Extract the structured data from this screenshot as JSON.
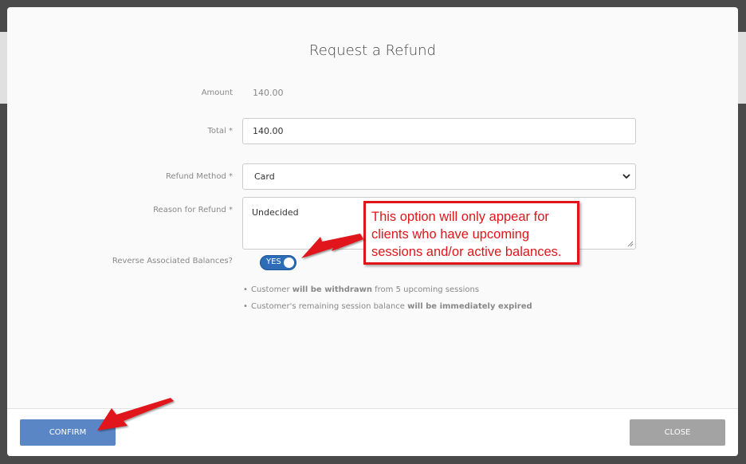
{
  "modal": {
    "title": "Request a Refund",
    "amount": {
      "label": "Amount",
      "value": "140.00"
    },
    "total": {
      "label": "Total *",
      "value": "140.00"
    },
    "refund_method": {
      "label": "Refund Method *",
      "value": "Card"
    },
    "reason": {
      "label": "Reason for Refund *",
      "value": "Undecided"
    },
    "reverse_balances": {
      "label": "Reverse Associated Balances?",
      "toggle_label": "YES",
      "on": true
    },
    "notes": [
      {
        "pre": "Customer ",
        "bold": "will be withdrawn",
        "post": " from 5 upcoming sessions"
      },
      {
        "pre": "Customer's remaining session balance ",
        "bold": "will be immediately expired",
        "post": ""
      }
    ]
  },
  "footer": {
    "confirm_label": "CONFIRM",
    "close_label": "CLOSE"
  },
  "annotation": {
    "text": "This option will only appear for clients who have upcoming sessions and/or active balances."
  },
  "colors": {
    "annotation_red": "#e0151a",
    "confirm_blue": "#5b86c6",
    "toggle_blue": "#2c6db5",
    "close_gray": "#a3a3a3"
  },
  "icons": [
    "chevron-down-icon",
    "resize-grip-icon",
    "red-arrow-icon"
  ]
}
